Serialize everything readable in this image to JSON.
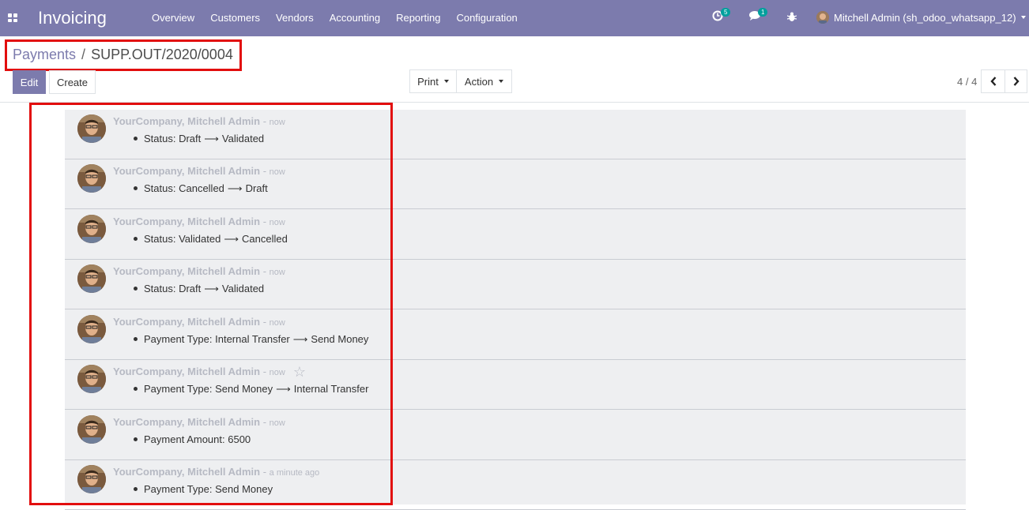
{
  "navbar": {
    "app_title": "Invoicing",
    "menu": [
      "Overview",
      "Customers",
      "Vendors",
      "Accounting",
      "Reporting",
      "Configuration"
    ],
    "activity_count": "5",
    "messages_count": "1",
    "user_label": "Mitchell Admin (sh_odoo_whatsapp_12)"
  },
  "breadcrumb": {
    "parent": "Payments",
    "separator": "/",
    "current": "SUPP.OUT/2020/0004"
  },
  "buttons": {
    "edit": "Edit",
    "create": "Create",
    "print": "Print",
    "action": "Action"
  },
  "pager": {
    "text": "4 / 4"
  },
  "messages": [
    {
      "author": "YourCompany, Mitchell Admin",
      "date": "now",
      "field": "Status",
      "old": "Draft",
      "new": "Validated"
    },
    {
      "author": "YourCompany, Mitchell Admin",
      "date": "now",
      "field": "Status",
      "old": "Cancelled",
      "new": "Draft"
    },
    {
      "author": "YourCompany, Mitchell Admin",
      "date": "now",
      "field": "Status",
      "old": "Validated",
      "new": "Cancelled"
    },
    {
      "author": "YourCompany, Mitchell Admin",
      "date": "now",
      "field": "Status",
      "old": "Draft",
      "new": "Validated"
    },
    {
      "author": "YourCompany, Mitchell Admin",
      "date": "now",
      "field": "Payment Type",
      "old": "Internal Transfer",
      "new": "Send Money"
    },
    {
      "author": "YourCompany, Mitchell Admin",
      "date": "now",
      "field": "Payment Type",
      "old": "Send Money",
      "new": "Internal Transfer"
    },
    {
      "author": "YourCompany, Mitchell Admin",
      "date": "now",
      "field": "Payment Amount",
      "old": "",
      "new": "6500"
    },
    {
      "author": "YourCompany, Mitchell Admin",
      "date": "a minute ago",
      "field": "Payment Type",
      "old": "",
      "new": "Send Money"
    }
  ],
  "colors": {
    "brand": "#7c7bad",
    "highlight": "#e20e0e",
    "chatter_bg": "#eeeff1"
  }
}
